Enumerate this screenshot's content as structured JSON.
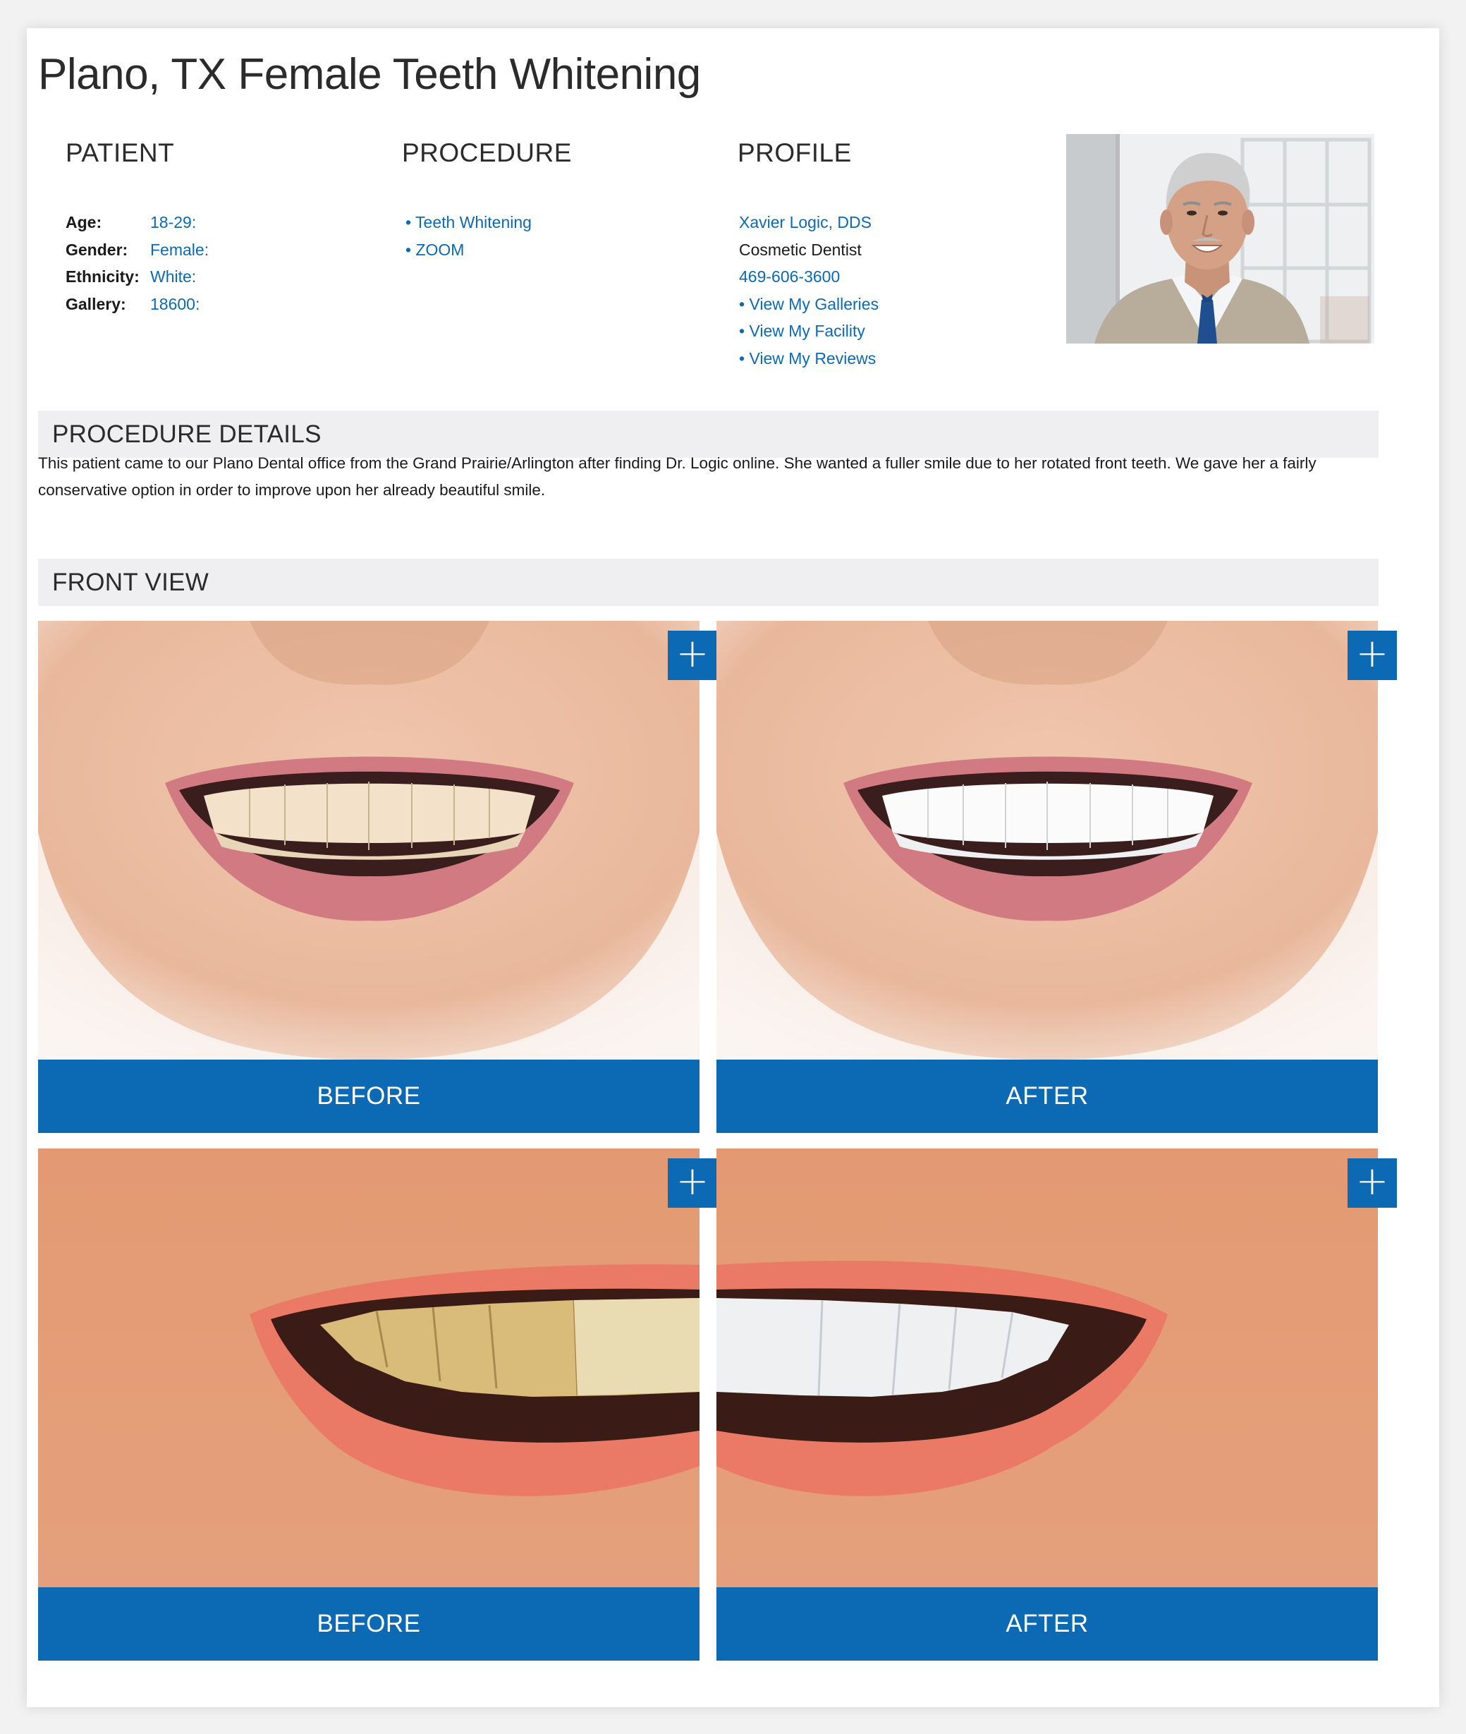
{
  "page": {
    "title": "Plano, TX Female Teeth Whitening"
  },
  "patient": {
    "heading": "PATIENT",
    "rows": [
      {
        "label": "Age:",
        "value": "18-29:"
      },
      {
        "label": "Gender:",
        "value": "Female:"
      },
      {
        "label": "Ethnicity:",
        "value": "White:"
      },
      {
        "label": "Gallery:",
        "value": "18600:"
      }
    ]
  },
  "procedure": {
    "heading": "PROCEDURE",
    "items": [
      "• Teeth Whitening",
      "• ZOOM"
    ]
  },
  "profile": {
    "heading": "PROFILE",
    "name": "Xavier Logic, DDS",
    "specialty": "Cosmetic Dentist",
    "phone": "469-606-3600",
    "links": [
      "• View My Galleries",
      "• View My Facility",
      "• View My Reviews"
    ]
  },
  "procedure_details": {
    "heading": "PROCEDURE DETAILS",
    "text": "This patient came to our Plano Dental office from the Grand Prairie/Arlington after finding Dr. Logic online. She wanted a fuller smile due to her rotated front teeth. We gave  her a fairly conservative option in order to improve upon her already beautiful smile."
  },
  "front_view": {
    "heading": "FRONT VIEW",
    "zoom_icon": "plus-icon",
    "zoom_label": "+",
    "captions": {
      "before_1": "BEFORE",
      "after_1": "AFTER",
      "before_2": "BEFORE",
      "after_2": "AFTER"
    }
  },
  "colors": {
    "accent": "#0b6ab3",
    "section_bar": "#efeff2",
    "heading_text": "#2b2b2b"
  }
}
